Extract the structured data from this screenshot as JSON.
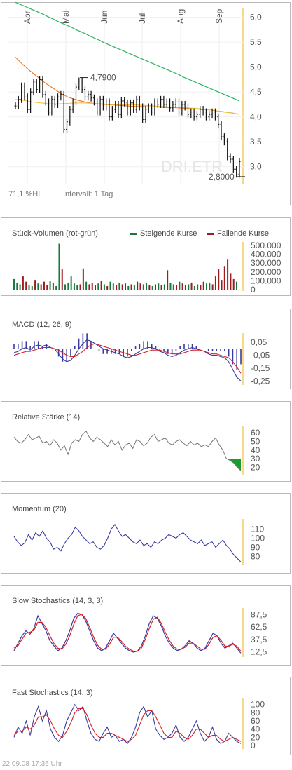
{
  "chart_data": [
    {
      "type": "candlestick",
      "months": [
        "Apr",
        "Mai",
        "Jun",
        "Jul",
        "Aug",
        "Sep"
      ],
      "y_ticks": [
        "6,0",
        "5,5",
        "5,0",
        "4,5",
        "4,0",
        "3,5",
        "3,0"
      ],
      "ylim": [
        2.7,
        6.15
      ],
      "high_label": "4,7900",
      "low_label": "2,8000",
      "high": 4.79,
      "low": 2.8,
      "watermark": "DRI.ETR",
      "info_left": "71,1 %HL",
      "info_right": "Intervall: 1 Tag",
      "close": [
        4.22,
        4.35,
        4.62,
        4.4,
        4.15,
        4.5,
        4.7,
        4.55,
        4.75,
        4.45,
        4.3,
        4.1,
        4.35,
        4.25,
        4.4,
        4.45,
        3.75,
        3.9,
        4.15,
        4.3,
        4.6,
        4.72,
        4.55,
        4.4,
        4.45,
        4.38,
        4.3,
        4.1,
        4.35,
        4.2,
        4.3,
        4.0,
        4.15,
        4.25,
        4.05,
        4.32,
        4.28,
        4.1,
        4.28,
        4.15,
        4.35,
        4.2,
        3.95,
        4.15,
        4.2,
        4.1,
        4.3,
        4.25,
        4.35,
        4.25,
        4.3,
        4.18,
        4.25,
        4.3,
        4.1,
        4.25,
        4.2,
        4.05,
        4.1,
        4.0,
        4.05,
        4.15,
        4.1,
        4.0,
        4.05,
        4.1,
        4.0,
        3.85,
        3.6,
        3.5,
        3.2,
        3.15,
        2.95,
        2.85,
        3.1
      ],
      "ma_green": [
        6.3,
        6.26,
        6.22,
        6.18,
        6.14,
        6.1,
        6.06,
        6.01,
        5.97,
        5.92,
        5.88,
        5.84,
        5.8,
        5.75,
        5.71,
        5.67,
        5.62,
        5.58,
        5.54,
        5.49,
        5.45,
        5.41,
        5.37,
        5.33,
        5.29,
        5.25,
        5.21,
        5.17,
        5.13,
        5.09,
        5.05,
        5.01,
        4.97,
        4.93,
        4.89,
        4.85,
        4.8,
        4.76,
        4.72,
        4.68,
        4.64,
        4.6,
        4.56,
        4.52,
        4.48,
        4.44,
        4.4,
        4.36,
        4.32
      ],
      "ma_orange": [
        5.2,
        5.05,
        4.92,
        4.8,
        4.68,
        4.58,
        4.48,
        4.4,
        4.35,
        4.31,
        4.28,
        4.26,
        4.25,
        4.24,
        4.23,
        4.22,
        4.21,
        4.21,
        4.2,
        4.2,
        4.19,
        4.19,
        4.18,
        4.17,
        4.16,
        4.15,
        4.14,
        4.12,
        4.1,
        4.08,
        4.05
      ],
      "ma_yellow": [
        4.35,
        4.33,
        4.3,
        4.28,
        4.26,
        4.26,
        4.27,
        4.28,
        4.28,
        4.27,
        4.26,
        4.25,
        4.24,
        4.24,
        4.24,
        4.23,
        4.22,
        4.21,
        4.2,
        4.19,
        4.18,
        4.17,
        4.15,
        4.13,
        4.1,
        4.08,
        4.05
      ]
    },
    {
      "type": "bar",
      "title": "Stück-Volumen (rot-grün)",
      "legend": [
        "Steigende Kurse",
        "Fallende Kurse"
      ],
      "y_ticks": [
        "500.000",
        "400.000",
        "300.000",
        "200.000",
        "100.000",
        "0"
      ],
      "ylim": [
        0,
        540000
      ],
      "values": [
        120000,
        80000,
        60000,
        150000,
        90000,
        50000,
        40000,
        110000,
        70000,
        60000,
        90000,
        50000,
        100000,
        80000,
        40000,
        520000,
        230000,
        60000,
        80000,
        150000,
        70000,
        50000,
        60000,
        240000,
        90000,
        60000,
        80000,
        50000,
        70000,
        100000,
        60000,
        40000,
        90000,
        70000,
        50000,
        80000,
        60000,
        70000,
        40000,
        60000,
        50000,
        90000,
        70000,
        60000,
        80000,
        50000,
        40000,
        60000,
        70000,
        50000,
        60000,
        220000,
        80000,
        60000,
        50000,
        90000,
        70000,
        50000,
        60000,
        80000,
        40000,
        60000,
        50000,
        90000,
        70000,
        80000,
        60000,
        150000,
        230000,
        110000,
        260000,
        340000,
        180000,
        120000,
        90000
      ]
    },
    {
      "type": "line",
      "title": "MACD (12, 26, 9)",
      "y_ticks": [
        "0,05",
        "-0,05",
        "-0,15",
        "-0,25"
      ],
      "ylim": [
        -0.27,
        0.1
      ],
      "macd": [
        -0.03,
        -0.02,
        0.0,
        0.01,
        -0.01,
        0.02,
        0.03,
        0.02,
        0.03,
        0.01,
        0.0,
        -0.04,
        -0.08,
        -0.1,
        -0.09,
        -0.05,
        0.0,
        0.04,
        0.07,
        0.06,
        0.04,
        0.02,
        0.0,
        -0.01,
        -0.02,
        -0.03,
        -0.04,
        -0.06,
        -0.07,
        -0.06,
        -0.04,
        -0.02,
        0.0,
        0.01,
        0.01,
        0.0,
        -0.02,
        -0.03,
        -0.05,
        -0.06,
        -0.05,
        -0.03,
        -0.01,
        0.0,
        0.01,
        0.0,
        -0.01,
        -0.02,
        -0.04,
        -0.05,
        -0.05,
        -0.06,
        -0.07,
        -0.1,
        -0.16,
        -0.22,
        -0.25
      ],
      "signal": [
        -0.05,
        -0.04,
        -0.03,
        -0.02,
        -0.02,
        -0.01,
        0.0,
        0.01,
        0.01,
        0.01,
        0.0,
        -0.01,
        -0.03,
        -0.05,
        -0.06,
        -0.06,
        -0.04,
        -0.02,
        0.01,
        0.03,
        0.04,
        0.03,
        0.02,
        0.01,
        0.0,
        -0.01,
        -0.02,
        -0.03,
        -0.04,
        -0.05,
        -0.05,
        -0.04,
        -0.03,
        -0.02,
        -0.01,
        -0.01,
        -0.01,
        -0.02,
        -0.03,
        -0.04,
        -0.04,
        -0.04,
        -0.03,
        -0.02,
        -0.01,
        -0.01,
        -0.01,
        -0.02,
        -0.03,
        -0.04,
        -0.04,
        -0.05,
        -0.06,
        -0.07,
        -0.1,
        -0.14,
        -0.19
      ]
    },
    {
      "type": "line",
      "title": "Relative Stärke (14)",
      "y_ticks": [
        "60",
        "50",
        "40",
        "30",
        "20"
      ],
      "ylim": [
        13,
        65
      ],
      "values": [
        55,
        50,
        48,
        52,
        58,
        52,
        54,
        56,
        48,
        50,
        45,
        52,
        48,
        40,
        45,
        35,
        48,
        52,
        50,
        58,
        62,
        54,
        50,
        55,
        52,
        48,
        44,
        52,
        46,
        50,
        40,
        46,
        48,
        42,
        52,
        50,
        45,
        48,
        55,
        58,
        50,
        52,
        54,
        48,
        46,
        50,
        52,
        48,
        45,
        50,
        46,
        48,
        44,
        46,
        44,
        50,
        54,
        46,
        40,
        30,
        28,
        25,
        20,
        16
      ],
      "oversold_fill_color": "#1a9e2a"
    },
    {
      "type": "line",
      "title": "Momentum (20)",
      "y_ticks": [
        "110",
        "100",
        "90",
        "80"
      ],
      "ylim": [
        72,
        118
      ],
      "values": [
        102,
        96,
        92,
        95,
        104,
        98,
        106,
        102,
        108,
        100,
        96,
        88,
        90,
        86,
        94,
        100,
        104,
        112,
        108,
        102,
        98,
        94,
        96,
        90,
        88,
        92,
        100,
        110,
        115,
        108,
        102,
        104,
        100,
        96,
        94,
        98,
        92,
        94,
        90,
        96,
        94,
        98,
        100,
        104,
        102,
        100,
        104,
        106,
        102,
        98,
        96,
        94,
        98,
        92,
        94,
        96,
        90,
        94,
        98,
        92,
        88,
        82,
        78,
        74
      ],
      "line_color": "#3a3aa0"
    },
    {
      "type": "line",
      "title": "Slow Stochastics (14, 3, 3)",
      "y_ticks": [
        "87,5",
        "62,5",
        "37,5",
        "12,5"
      ],
      "ylim": [
        5,
        95
      ],
      "k": [
        15,
        30,
        45,
        55,
        48,
        60,
        85,
        70,
        55,
        35,
        25,
        15,
        20,
        35,
        55,
        80,
        90,
        88,
        75,
        55,
        35,
        20,
        15,
        20,
        35,
        50,
        40,
        30,
        20,
        15,
        12,
        14,
        25,
        45,
        70,
        85,
        80,
        65,
        45,
        30,
        20,
        15,
        18,
        25,
        35,
        30,
        20,
        15,
        20,
        35,
        50,
        45,
        30,
        20,
        25,
        30,
        20,
        10
      ],
      "d": [
        20,
        25,
        38,
        50,
        52,
        56,
        72,
        72,
        62,
        45,
        30,
        20,
        18,
        28,
        45,
        68,
        85,
        88,
        80,
        62,
        42,
        26,
        18,
        18,
        28,
        42,
        42,
        34,
        24,
        18,
        14,
        14,
        20,
        38,
        60,
        78,
        82,
        70,
        52,
        36,
        24,
        18,
        18,
        22,
        30,
        30,
        24,
        18,
        18,
        28,
        42,
        45,
        36,
        24,
        24,
        28,
        24,
        14
      ],
      "k_color": "#3a3aa0",
      "d_color": "#d81f26"
    },
    {
      "type": "line",
      "title": "Fast Stochastics (14, 3)",
      "y_ticks": [
        "100",
        "80",
        "60",
        "40",
        "20",
        "0"
      ],
      "ylim": [
        -5,
        108
      ],
      "k": [
        20,
        45,
        30,
        60,
        25,
        70,
        95,
        60,
        85,
        40,
        20,
        10,
        25,
        60,
        80,
        100,
        85,
        95,
        60,
        30,
        15,
        10,
        30,
        45,
        20,
        25,
        10,
        15,
        5,
        20,
        45,
        80,
        95,
        70,
        85,
        40,
        25,
        15,
        20,
        30,
        50,
        20,
        10,
        20,
        40,
        60,
        30,
        10,
        20,
        45,
        15,
        5,
        10,
        30,
        20,
        10,
        5
      ],
      "d": [
        25,
        35,
        35,
        45,
        40,
        50,
        70,
        70,
        75,
        60,
        40,
        25,
        20,
        35,
        55,
        80,
        90,
        90,
        75,
        50,
        30,
        20,
        20,
        30,
        30,
        25,
        20,
        15,
        10,
        15,
        25,
        50,
        75,
        85,
        85,
        70,
        50,
        30,
        20,
        20,
        35,
        30,
        20,
        15,
        25,
        40,
        40,
        30,
        20,
        25,
        25,
        15,
        10,
        15,
        20,
        15,
        10
      ],
      "k_color": "#3a3aa0",
      "d_color": "#d81f26"
    }
  ],
  "footer": "22.09.08  17:36 Uhr",
  "colors": {
    "rising": "#1a7a3a",
    "falling": "#9e1b1f",
    "today_marker": "#f7d98a",
    "ma_green": "#2db35d",
    "ma_orange": "#e8742a",
    "ma_yellow": "#f0c040"
  }
}
